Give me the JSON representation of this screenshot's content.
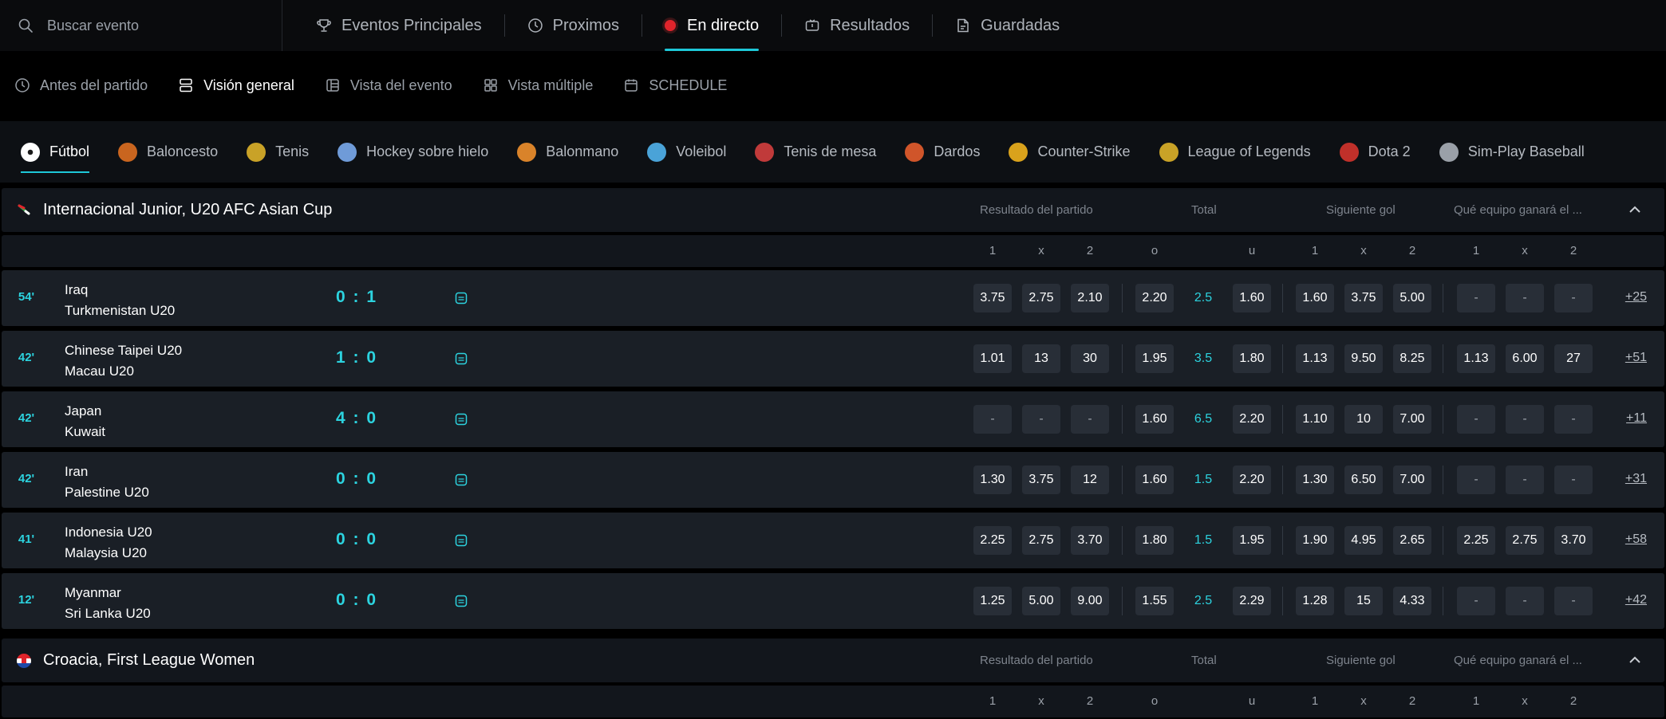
{
  "search": {
    "placeholder": "Buscar evento"
  },
  "nav": {
    "tabs": [
      "Eventos Principales",
      "Proximos",
      "En directo",
      "Resultados",
      "Guardadas"
    ]
  },
  "subnav": {
    "tabs": [
      "Antes del partido",
      "Visión general",
      "Vista del evento",
      "Vista múltiple",
      "SCHEDULE"
    ]
  },
  "sports": [
    {
      "label": "Fútbol",
      "color": "#ffffff"
    },
    {
      "label": "Baloncesto",
      "color": "#c9651f"
    },
    {
      "label": "Tenis",
      "color": "#c9a227"
    },
    {
      "label": "Hockey sobre hielo",
      "color": "#6f9bd8"
    },
    {
      "label": "Balonmano",
      "color": "#d9832a"
    },
    {
      "label": "Voleibol",
      "color": "#4aa3d8"
    },
    {
      "label": "Tenis de mesa",
      "color": "#c03a3a"
    },
    {
      "label": "Dardos",
      "color": "#d0552a"
    },
    {
      "label": "Counter-Strike",
      "color": "#d9a21c"
    },
    {
      "label": "League of Legends",
      "color": "#c9a227"
    },
    {
      "label": "Dota 2",
      "color": "#c0302a"
    },
    {
      "label": "Sim-Play Baseball",
      "color": "#9aa0a8"
    }
  ],
  "markets": {
    "result": "Resultado del partido",
    "total": "Total",
    "next_goal": "Siguiente gol",
    "which_team": "Qué equipo ganará el ..."
  },
  "columns": [
    "1",
    "x",
    "2",
    "o",
    "u",
    "1",
    "x",
    "2",
    "1",
    "x",
    "2"
  ],
  "leagues": [
    {
      "name": "Internacional Junior, U20 AFC Asian Cup",
      "matches": [
        {
          "minute": "54'",
          "home": "Iraq",
          "away": "Turkmenistan U20",
          "score": "0 : 1",
          "odds": [
            "3.75",
            "2.75",
            "2.10",
            "2.20",
            "2.5",
            "1.60",
            "1.60",
            "3.75",
            "5.00",
            "-",
            "-",
            "-"
          ],
          "more": "+25"
        },
        {
          "minute": "42'",
          "home": "Chinese Taipei U20",
          "away": "Macau U20",
          "score": "1 : 0",
          "odds": [
            "1.01",
            "13",
            "30",
            "1.95",
            "3.5",
            "1.80",
            "1.13",
            "9.50",
            "8.25",
            "1.13",
            "6.00",
            "27"
          ],
          "more": "+51"
        },
        {
          "minute": "42'",
          "home": "Japan",
          "away": "Kuwait",
          "score": "4 : 0",
          "odds": [
            "-",
            "-",
            "-",
            "1.60",
            "6.5",
            "2.20",
            "1.10",
            "10",
            "7.00",
            "-",
            "-",
            "-"
          ],
          "more": "+11"
        },
        {
          "minute": "42'",
          "home": "Iran",
          "away": "Palestine U20",
          "score": "0 : 0",
          "odds": [
            "1.30",
            "3.75",
            "12",
            "1.60",
            "1.5",
            "2.20",
            "1.30",
            "6.50",
            "7.00",
            "-",
            "-",
            "-"
          ],
          "more": "+31"
        },
        {
          "minute": "41'",
          "home": "Indonesia U20",
          "away": "Malaysia U20",
          "score": "0 : 0",
          "odds": [
            "2.25",
            "2.75",
            "3.70",
            "1.80",
            "1.5",
            "1.95",
            "1.90",
            "4.95",
            "2.65",
            "2.25",
            "2.75",
            "3.70"
          ],
          "more": "+58"
        },
        {
          "minute": "12'",
          "home": "Myanmar",
          "away": "Sri Lanka U20",
          "score": "0 : 0",
          "odds": [
            "1.25",
            "5.00",
            "9.00",
            "1.55",
            "2.5",
            "2.29",
            "1.28",
            "15",
            "4.33",
            "-",
            "-",
            "-"
          ],
          "more": "+42"
        }
      ]
    },
    {
      "name": "Croacia, First League Women",
      "matches": []
    }
  ],
  "colors": {
    "accent": "#1ec8d8",
    "live": "#e0242b",
    "odd_bg": "#282e37",
    "row_bg": "#1a1f26"
  }
}
